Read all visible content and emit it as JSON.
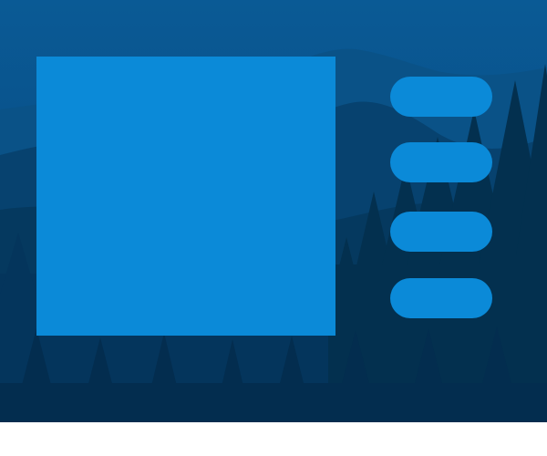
{
  "colors": {
    "sky_top": "#0a5a95",
    "sky_bottom": "#06487a",
    "mountain_far": "#0a5287",
    "mountain_mid": "#07426f",
    "forest": "#04355c",
    "forest_dark": "#032d4f",
    "panel": "#0b8ad8",
    "button": "#0b8ad8",
    "footer": "#ffffff"
  },
  "background": {
    "scene": "mountain-forest-landscape"
  },
  "main_panel": {
    "content": ""
  },
  "side_buttons": [
    {
      "label": "",
      "icon": ""
    },
    {
      "label": "",
      "icon": ""
    },
    {
      "label": "",
      "icon": ""
    },
    {
      "label": "",
      "icon": ""
    }
  ]
}
